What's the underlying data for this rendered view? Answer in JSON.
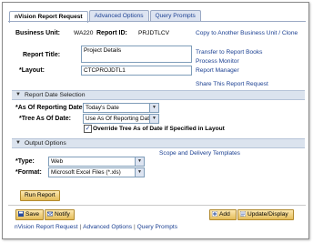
{
  "tabs": [
    "nVision Report Request",
    "Advanced Options",
    "Query Prompts"
  ],
  "header": {
    "business_unit_label": "Business Unit:",
    "business_unit_value": "WA220",
    "report_id_label": "Report ID:",
    "report_id_value": "PRJDTLCV",
    "copy_link": "Copy to Another Business Unit / Clone"
  },
  "form": {
    "report_title_label": "Report Title:",
    "report_title_value": "Project Details",
    "layout_label": "*Layout:",
    "layout_value": "CTCPROJDTL1"
  },
  "side_links": [
    "Transfer to Report Books",
    "Process Monitor",
    "Report Manager",
    "Share This Report Request"
  ],
  "report_date_section": {
    "title": "Report Date Selection",
    "as_of_label": "*As Of Reporting Date:",
    "as_of_value": "Today's Date",
    "tree_label": "*Tree As Of Date:",
    "tree_value": "Use As Of Reporting Date",
    "override_label": "Override Tree As of Date if Specified in Layout",
    "override_checked": true
  },
  "output_section": {
    "title": "Output Options",
    "scope_link": "Scope and Delivery Templates",
    "type_label": "*Type:",
    "type_value": "Web",
    "format_label": "*Format:",
    "format_value": "Microsoft Excel Files (*.xls)"
  },
  "buttons": {
    "run_report": "Run Report",
    "save": "Save",
    "notify": "Notify",
    "add": "Add",
    "update_display": "Update/Display"
  },
  "footer_links": [
    "nVision Report Request",
    "Advanced Options",
    "Query Prompts"
  ],
  "footer_sep": "|",
  "colors": {
    "link": "#1a3f91",
    "section_bg": "#dbe3ee",
    "button_bg": "#e5bd5a"
  }
}
